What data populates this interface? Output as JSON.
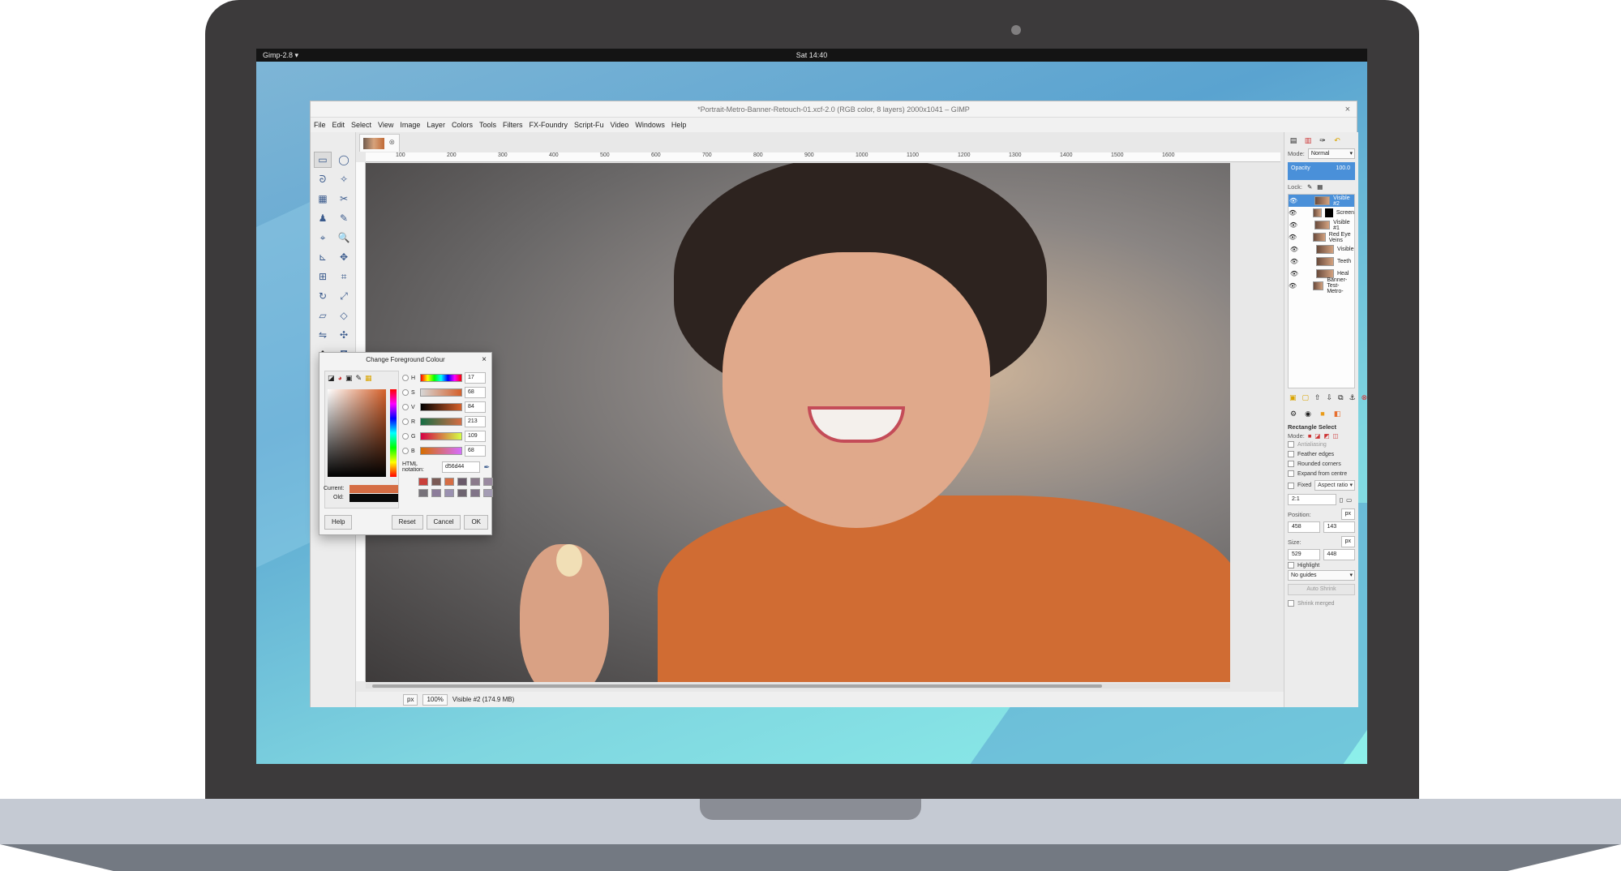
{
  "topbar": {
    "app_menu": "Gimp-2.8 ▾",
    "clock": "Sat 14:40"
  },
  "window": {
    "title": "*Portrait-Metro-Banner-Retouch-01.xcf-2.0 (RGB color, 8 layers) 2000x1041 – GIMP",
    "close": "×"
  },
  "menu": [
    "File",
    "Edit",
    "Select",
    "View",
    "Image",
    "Layer",
    "Colors",
    "Tools",
    "Filters",
    "FX-Foundry",
    "Script-Fu",
    "Video",
    "Windows",
    "Help"
  ],
  "image_tab": {
    "close": "⊗"
  },
  "ruler_ticks": [
    "100",
    "200",
    "300",
    "400",
    "500",
    "600",
    "700",
    "800",
    "900",
    "1000",
    "1100",
    "1200",
    "1300",
    "1400",
    "1500",
    "1600"
  ],
  "status": {
    "unit": "px",
    "zoom": "100%",
    "layer_info": "Visible #2 (174.9 MB)"
  },
  "layers_panel": {
    "mode_label": "Mode:",
    "mode_value": "Normal",
    "opacity_label": "Opacity",
    "opacity_value": "100.0",
    "lock_label": "Lock:",
    "layers": [
      {
        "name": "Visible #2",
        "selected": true,
        "mask": false
      },
      {
        "name": "Screen",
        "selected": false,
        "mask": true
      },
      {
        "name": "Visible #1",
        "selected": false,
        "mask": false
      },
      {
        "name": "Red Eye Veins",
        "selected": false,
        "mask": false
      },
      {
        "name": "Visible",
        "selected": false,
        "mask": false
      },
      {
        "name": "Teeth",
        "selected": false,
        "mask": false
      },
      {
        "name": "Heal",
        "selected": false,
        "mask": false
      },
      {
        "name": "Banner-Test-Metro-",
        "selected": false,
        "mask": false
      }
    ]
  },
  "tool_options": {
    "title": "Rectangle Select",
    "mode_label": "Mode:",
    "antialiasing": "Antialiasing",
    "feather": "Feather edges",
    "rounded": "Rounded corners",
    "expand": "Expand from centre",
    "fixed": "Fixed",
    "fixed_value": "Aspect ratio",
    "ratio": "2:1",
    "position_label": "Position:",
    "pos_x": "458",
    "pos_y": "143",
    "size_label": "Size:",
    "size_w": "529",
    "size_h": "448",
    "unit": "px",
    "highlight": "Highlight",
    "guides": "No guides",
    "auto_shrink": "Auto Shrink",
    "shrink_merged": "Shrink merged"
  },
  "color_dialog": {
    "title": "Change Foreground Colour",
    "close": "×",
    "channels": [
      {
        "name": "H",
        "value": "17"
      },
      {
        "name": "S",
        "value": "68"
      },
      {
        "name": "V",
        "value": "84"
      },
      {
        "name": "R",
        "value": "213"
      },
      {
        "name": "G",
        "value": "109"
      },
      {
        "name": "B",
        "value": "68"
      }
    ],
    "html_label": "HTML notation:",
    "html_value": "d56d44",
    "current_label": "Current:",
    "old_label": "Old:",
    "current_color": "#d56d44",
    "old_color": "#0a0a0a",
    "buttons": {
      "help": "Help",
      "reset": "Reset",
      "cancel": "Cancel",
      "ok": "OK"
    }
  }
}
